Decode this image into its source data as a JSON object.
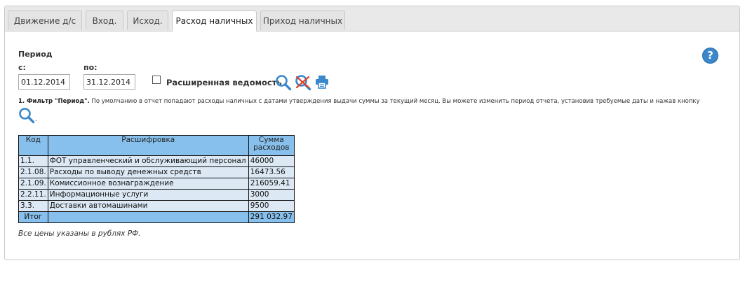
{
  "tabs": [
    {
      "label": "Движение д/с"
    },
    {
      "label": "Вход."
    },
    {
      "label": "Исход."
    },
    {
      "label": "Расход наличных",
      "active": true
    },
    {
      "label": "Приход наличных"
    }
  ],
  "filter": {
    "period_label": "Период",
    "from_label": "с:",
    "to_label": "по:",
    "from_value": "01.12.2014",
    "to_value": "31.12.2014",
    "extended_label": "Расширенная ведомость",
    "extended_checked": false
  },
  "help_icon": "?",
  "note": {
    "bold": "1. Фильтр \"Период\".",
    "text": " По умолчанию в отчет попадают расходы наличных с датами утверждения выдачи суммы за текущий месяц. Вы можете изменить период отчета, установив требуемые даты и нажав кнопку",
    "tail": "."
  },
  "table": {
    "headers": [
      "Код",
      "Расшифровка",
      "Сумма расходов"
    ],
    "header_amount_line1": "Сумма",
    "header_amount_line2": "расходов",
    "rows": [
      {
        "code": "1.1.",
        "desc": "ФОТ управленческий и обслуживающий персонал",
        "amount": "46000"
      },
      {
        "code": "2.1.08.",
        "desc": "Расходы по выводу денежных средств",
        "amount": "16473.56"
      },
      {
        "code": "2.1.09.",
        "desc": "Комиссионное вознаграждение",
        "amount": "216059.41"
      },
      {
        "code": "2.2.11.",
        "desc": "Информационные услуги",
        "amount": "3000"
      },
      {
        "code": "3.3.",
        "desc": "Доставки автомашинами",
        "amount": "9500"
      }
    ],
    "total_label": "Итог",
    "total_value": "291 032.97"
  },
  "footnote": "Все цены указаны в рублях РФ.",
  "colors": {
    "header_bg": "#87c0ec",
    "row_bg": "#dce9f5",
    "icon_blue": "#3a87cc",
    "clear_red": "#e0432a"
  }
}
